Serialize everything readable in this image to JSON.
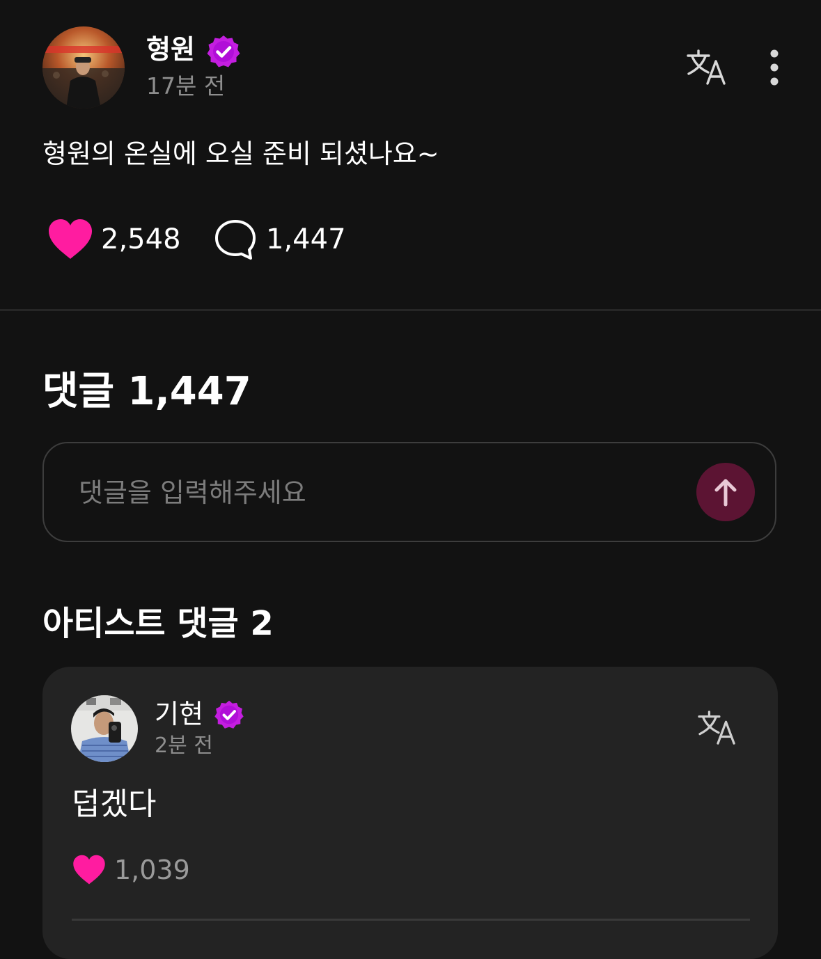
{
  "post": {
    "author": "형원",
    "time": "17분 전",
    "body": "형원의 온실에 오실 준비 되셨나요~",
    "likes": "2,548",
    "comments": "1,447"
  },
  "comments_section": {
    "heading": "댓글 1,447",
    "input_placeholder": "댓글을 입력해주세요"
  },
  "artist_comments": {
    "heading": "아티스트 댓글 2",
    "items": [
      {
        "author": "기현",
        "time": "2분 전",
        "text": "덥겠다",
        "likes": "1,039"
      }
    ]
  },
  "colors": {
    "background": "#121212",
    "card": "#232323",
    "accent_pink": "#ff1ca0",
    "badge_purple": "#c41ee0",
    "send_button": "#5c1433",
    "muted_text": "#8e8e8e"
  },
  "icons": {
    "verified": "verified-badge-icon",
    "translate": "translate-icon",
    "more": "more-vertical-icon",
    "like": "heart-icon",
    "comment": "comment-bubble-icon",
    "send": "arrow-up-icon"
  }
}
